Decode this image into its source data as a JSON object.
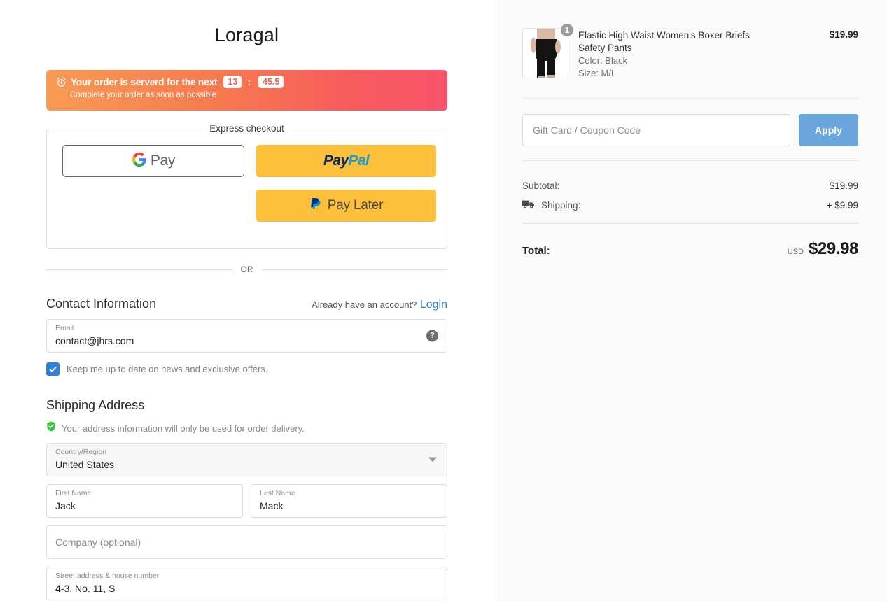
{
  "brand": {
    "name": "Loragal"
  },
  "timer": {
    "icon": "alarm-clock-icon",
    "title": "Your order is serverd for the next",
    "minutes": "13",
    "separator": ":",
    "seconds": "45.5",
    "subtitle": "Complete your order as soon as possible",
    "gradient_start": "#f79b54",
    "gradient_end": "#f8536b",
    "badge_text_color": "#f7604f"
  },
  "express": {
    "legend": "Express checkout",
    "gpay": {
      "label": "Pay",
      "icon": "google-g-icon"
    },
    "paypal": {
      "pay": "Pay",
      "pal": "Pal",
      "bg": "#fcc03a"
    },
    "paylater": {
      "label": "Pay Later",
      "icon": "paypal-p-icon"
    }
  },
  "divider": {
    "or": "OR"
  },
  "contact": {
    "title": "Contact Information",
    "account_note": "Already have an account?",
    "login_label": "Login",
    "email": {
      "label": "Email",
      "value": "contact@jhrs.com",
      "help_icon": "question-mark-icon"
    },
    "newsletter": {
      "label": "Keep me up to date on news and exclusive offers.",
      "checked": true
    }
  },
  "shipping": {
    "title": "Shipping Address",
    "privacy_note": "Your address information will only be used for order delivery.",
    "privacy_icon": "shield-check-icon",
    "country": {
      "label": "Country/Region",
      "value": "United States"
    },
    "first_name": {
      "label": "First Name",
      "value": "Jack"
    },
    "last_name": {
      "label": "Last Name",
      "value": "Mack"
    },
    "company": {
      "placeholder": "Company (optional)"
    },
    "street": {
      "label": "Street address & house number",
      "value": "4-3, No. 11, S"
    }
  },
  "summary": {
    "item": {
      "name": "Elastic High Waist Women's Boxer Briefs Safety Pants",
      "color": "Color: Black",
      "size": "Size: M/L",
      "price": "$19.99",
      "qty": "1"
    },
    "coupon": {
      "placeholder": "Gift Card / Coupon Code",
      "apply_label": "Apply",
      "apply_color": "#6aa6db"
    },
    "subtotal_label": "Subtotal:",
    "subtotal_value": "$19.99",
    "shipping_label": "Shipping:",
    "shipping_value": "+ $9.99",
    "shipping_icon": "truck-icon",
    "total_label": "Total:",
    "currency": "USD",
    "total_value": "$29.98"
  }
}
